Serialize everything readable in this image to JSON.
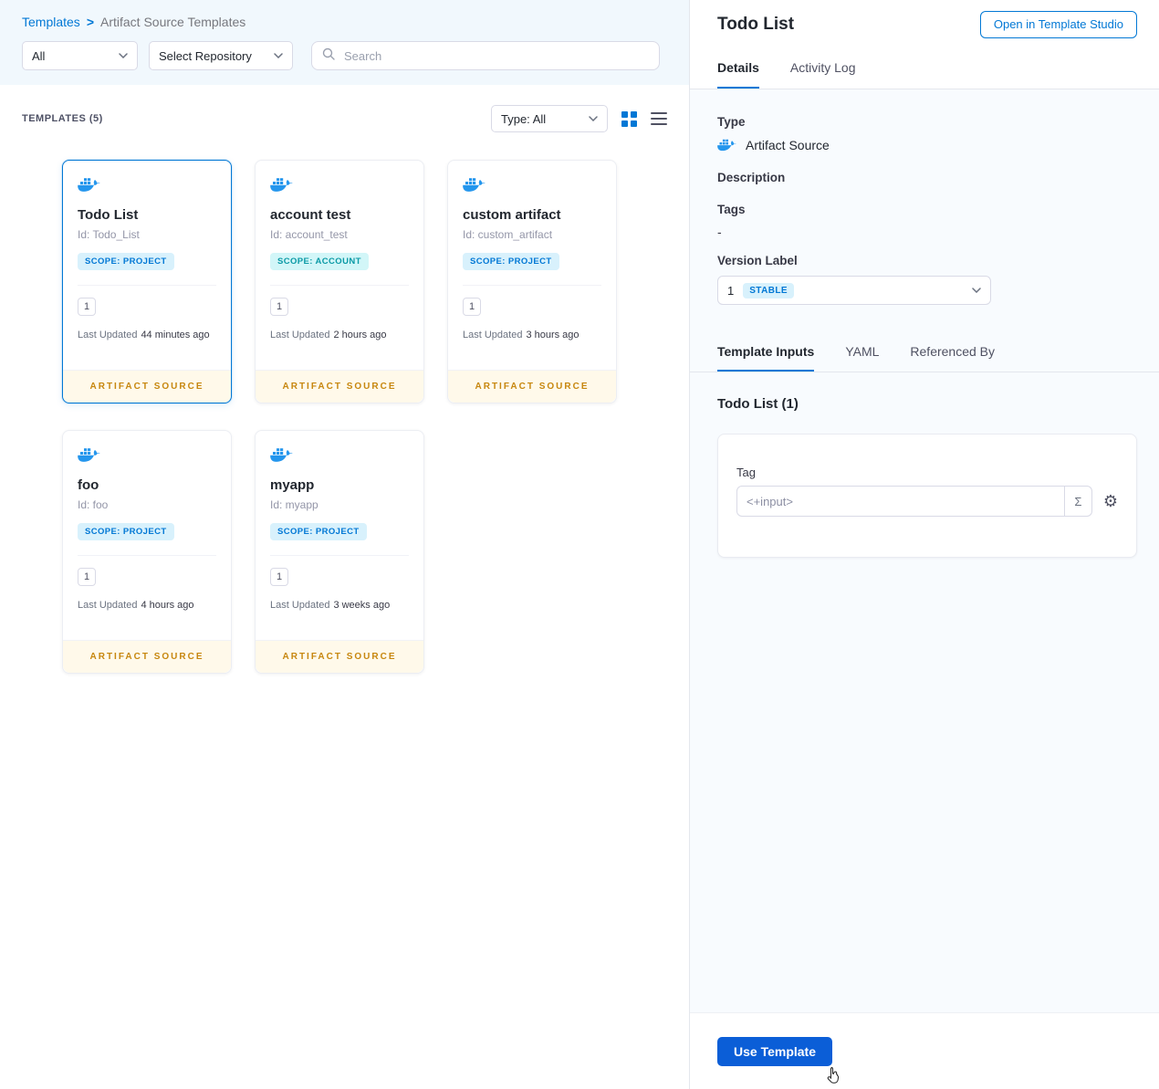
{
  "breadcrumb": {
    "templates": "Templates",
    "separator": ">",
    "current": "Artifact Source Templates"
  },
  "filters": {
    "scope": "All",
    "repository": "Select Repository",
    "search_placeholder": "Search"
  },
  "list_header": {
    "count": "TEMPLATES (5)",
    "type_filter": "Type: All"
  },
  "labels": {
    "last_updated": "Last Updated"
  },
  "cards": [
    {
      "title": "Todo List",
      "id": "Id: Todo_List",
      "scope": "SCOPE: PROJECT",
      "version": "1",
      "updated": "44 minutes ago",
      "footer": "ARTIFACT SOURCE"
    },
    {
      "title": "account test",
      "id": "Id: account_test",
      "scope": "SCOPE: ACCOUNT",
      "version": "1",
      "updated": "2 hours ago",
      "footer": "ARTIFACT SOURCE"
    },
    {
      "title": "custom artifact",
      "id": "Id: custom_artifact",
      "scope": "SCOPE: PROJECT",
      "version": "1",
      "updated": "3 hours ago",
      "footer": "ARTIFACT SOURCE"
    },
    {
      "title": "foo",
      "id": "Id: foo",
      "scope": "SCOPE: PROJECT",
      "version": "1",
      "updated": "4 hours ago",
      "footer": "ARTIFACT SOURCE"
    },
    {
      "title": "myapp",
      "id": "Id: myapp",
      "scope": "SCOPE: PROJECT",
      "version": "1",
      "updated": "3 weeks ago",
      "footer": "ARTIFACT SOURCE"
    }
  ],
  "panel": {
    "title": "Todo List",
    "open_in_studio": "Open in Template Studio",
    "tabs": [
      "Details",
      "Activity Log"
    ],
    "details": {
      "type_label": "Type",
      "type_value": "Artifact Source",
      "description_label": "Description",
      "tags_label": "Tags",
      "tags_value": "-",
      "version_label": "Version Label",
      "version_value": "1",
      "version_badge": "STABLE"
    },
    "inputs_tabs": [
      "Template Inputs",
      "YAML",
      "Referenced By"
    ],
    "inputs": {
      "heading": "Todo List (1)",
      "tag_label": "Tag",
      "tag_value": "<+input>"
    },
    "use_template": "Use Template"
  },
  "icons": {
    "sigma": "Σ",
    "gear": "⚙"
  },
  "colors": {
    "primary": "#0278d5",
    "docker_blue": "#2496ed",
    "artifact_footer_text": "#c7870f",
    "scope_project_text": "#0278d5",
    "scope_account_text": "#0b9aa6",
    "use_button": "#0b5ed7"
  }
}
